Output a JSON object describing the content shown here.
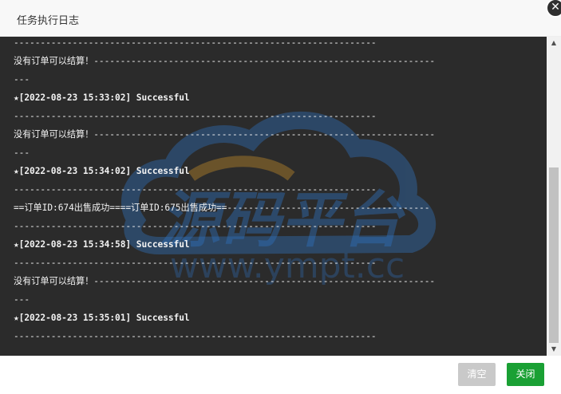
{
  "dialog": {
    "title": "任务执行日志",
    "close_glyph": "✕"
  },
  "log": {
    "lines": [
      {
        "text": "--------------------------------------------------------------------",
        "bold": false
      },
      {
        "text": "没有订单可以结算！----------------------------------------------------------------",
        "bold": false
      },
      {
        "text": "---",
        "bold": false
      },
      {
        "text": "★[2022-08-23 15:33:02] Successful",
        "bold": true
      },
      {
        "text": "--------------------------------------------------------------------",
        "bold": false
      },
      {
        "text": "没有订单可以结算！----------------------------------------------------------------",
        "bold": false
      },
      {
        "text": "---",
        "bold": false
      },
      {
        "text": "★[2022-08-23 15:34:02] Successful",
        "bold": true
      },
      {
        "text": "--------------------------------------------------------------------",
        "bold": false
      },
      {
        "text": "==订单ID:674出售成功====订单ID:675出售成功==--------------------------------------",
        "bold": false
      },
      {
        "text": "--------------------------------------------------------------------",
        "bold": false
      },
      {
        "text": "★[2022-08-23 15:34:58] Successful",
        "bold": true
      },
      {
        "text": "--------------------------------------------------------------------",
        "bold": false
      },
      {
        "text": "没有订单可以结算！----------------------------------------------------------------",
        "bold": false
      },
      {
        "text": "---",
        "bold": false
      },
      {
        "text": "★[2022-08-23 15:35:01] Successful",
        "bold": true
      },
      {
        "text": "--------------------------------------------------------------------",
        "bold": false
      }
    ]
  },
  "watermark": {
    "title": "源码平台",
    "url": "www.ympt.cc"
  },
  "scrollbar": {
    "up_glyph": "▲",
    "down_glyph": "▼"
  },
  "footer": {
    "clear_label": "清空",
    "close_label": "关闭"
  },
  "colors": {
    "log_bg": "#2b2b2b",
    "primary_button": "#1aa034",
    "disabled_button": "#c9c9c9",
    "watermark_blue": "#2f6fb8",
    "watermark_gold": "#c28a2a"
  }
}
